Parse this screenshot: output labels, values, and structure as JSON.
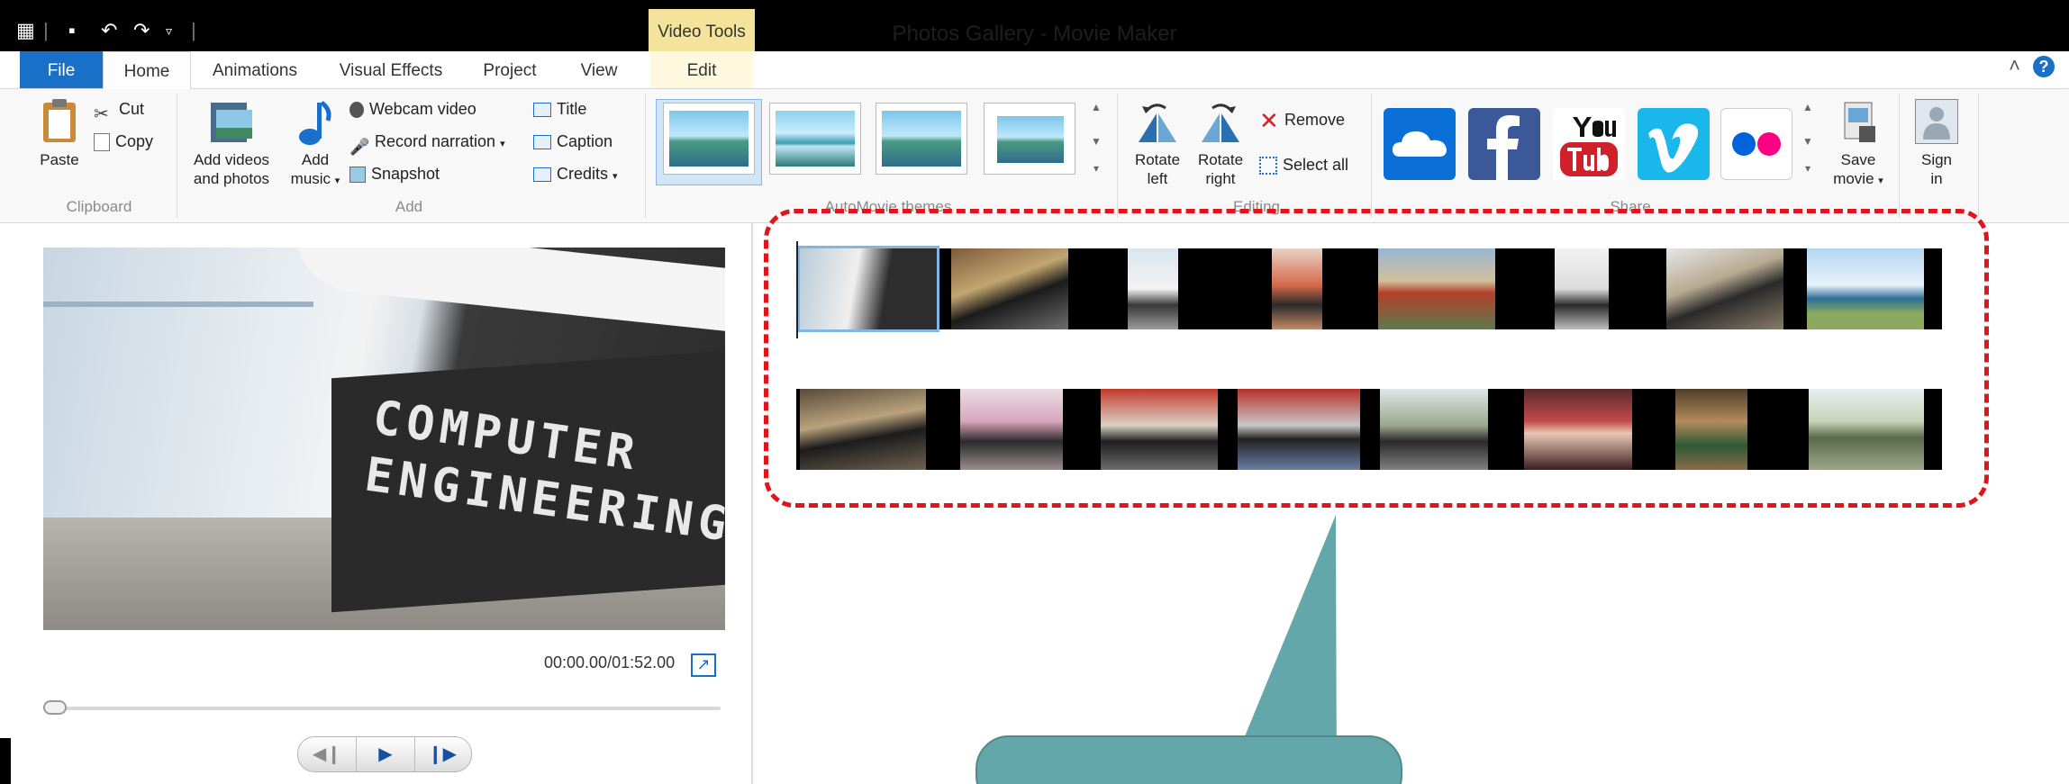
{
  "window": {
    "title": "Photos Gallery - Movie Maker",
    "contextual_tab": "Video Tools"
  },
  "tabs": [
    "File",
    "Home",
    "Animations",
    "Visual Effects",
    "Project",
    "View",
    "Edit"
  ],
  "ribbon": {
    "clipboard": {
      "label": "Clipboard",
      "paste": "Paste",
      "cut": "Cut",
      "copy": "Copy"
    },
    "add": {
      "label": "Add",
      "add_videos": [
        "Add videos",
        "and photos"
      ],
      "add_music": [
        "Add",
        "music"
      ],
      "webcam": "Webcam video",
      "narration": "Record narration",
      "snapshot": "Snapshot",
      "title": "Title",
      "caption": "Caption",
      "credits": "Credits"
    },
    "themes": {
      "label": "AutoMovie themes"
    },
    "editing": {
      "label": "Editing",
      "rotate_left": [
        "Rotate",
        "left"
      ],
      "rotate_right": [
        "Rotate",
        "right"
      ],
      "remove": "Remove",
      "select_all": "Select all"
    },
    "share": {
      "label": "Share",
      "save_movie": [
        "Save",
        "movie"
      ],
      "sign_in": [
        "Sign",
        "in"
      ]
    }
  },
  "preview": {
    "poster_text": [
      "COMPUTER",
      "ENGINEERING"
    ],
    "timecode": "00:00.00/01:52.00",
    "seek_value": 0
  },
  "colors": {
    "accent": "#1a6fc9",
    "selection_outline": "#e1141b",
    "callout": "#64a7aa",
    "contextual": "#f4e39a"
  }
}
